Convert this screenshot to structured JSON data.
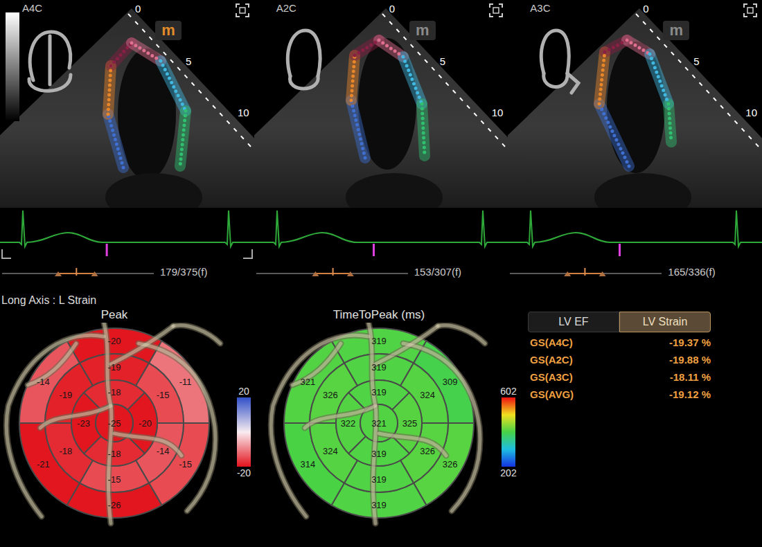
{
  "views": [
    {
      "label": "A4C",
      "selected": true,
      "grayscale_bar": true,
      "badge": "m",
      "badge_active": true,
      "depth_marks": [
        "0",
        "5",
        "10"
      ],
      "ecg_marker": 0.42,
      "roi_start": 0.37,
      "roi_end": 0.61,
      "frame": "179/375(f)"
    },
    {
      "label": "A2C",
      "selected": false,
      "grayscale_bar": false,
      "badge": "m",
      "badge_active": false,
      "depth_marks": [
        "0",
        "5",
        "10"
      ],
      "ecg_marker": 0.47,
      "roi_start": 0.39,
      "roi_end": 0.62,
      "frame": "153/307(f)"
    },
    {
      "label": "A3C",
      "selected": false,
      "grayscale_bar": false,
      "badge": "m",
      "badge_active": false,
      "depth_marks": [
        "0",
        "5",
        "10"
      ],
      "ecg_marker": 0.44,
      "roi_start": 0.38,
      "roi_end": 0.61,
      "frame": "165/336(f)"
    }
  ],
  "strain_title": "Long Axis : L Strain",
  "peak": {
    "title": "Peak",
    "basal": [
      "-20",
      "-11",
      "-15",
      "-26",
      "-21",
      "-14"
    ],
    "mid": [
      "-19",
      "-15",
      "-14",
      "-15",
      "-18",
      "-19"
    ],
    "apical": [
      "-18",
      "-20",
      "-18",
      "-23"
    ],
    "apex": "-25",
    "scale_max": "20",
    "scale_min": "-20"
  },
  "time_to_peak": {
    "title": "TimeToPeak (ms)",
    "basal": [
      "319",
      "309",
      "326",
      "319",
      "314",
      "321"
    ],
    "mid": [
      "319",
      "324",
      "326",
      "319",
      "324",
      "326"
    ],
    "apical": [
      "319",
      "325",
      "319",
      "322"
    ],
    "apex": "321",
    "scale_max": "602",
    "scale_min": "202"
  },
  "tabs": [
    {
      "label": "LV EF",
      "selected": false
    },
    {
      "label": "LV Strain",
      "selected": true
    }
  ],
  "global_strain": [
    {
      "label": "GS(A4C)",
      "value": "-19.37 %"
    },
    {
      "label": "GS(A2C)",
      "value": "-19.88 %"
    },
    {
      "label": "GS(A3C)",
      "value": "-18.11 %"
    },
    {
      "label": "GS(AVG)",
      "value": "-19.12 %"
    }
  ]
}
